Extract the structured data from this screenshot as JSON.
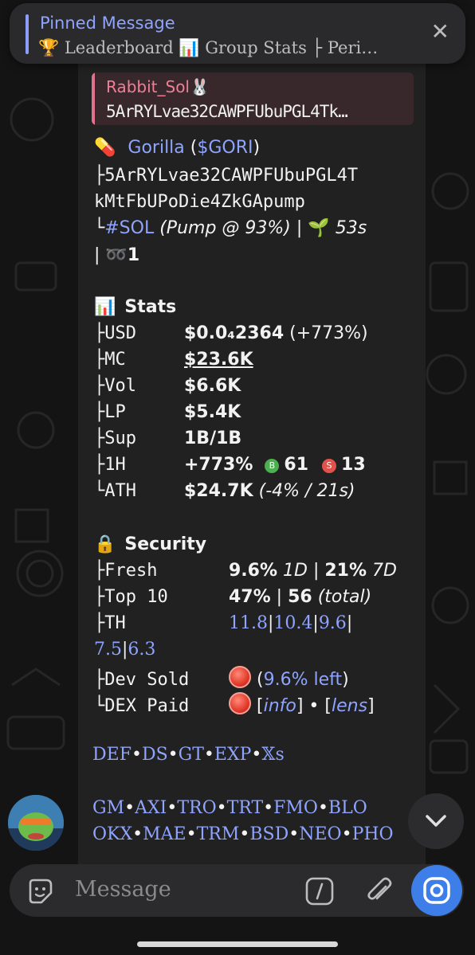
{
  "pinned": {
    "title": "Pinned Message",
    "preview": "🏆 Leaderboard  📊 Group Stats  ├ Peri…",
    "close_icon": "close-icon"
  },
  "reply": {
    "name": "Rabbit_Sol🐰",
    "text": "5ArRYLvae32CAWPFUbuPGL4Tk…"
  },
  "token": {
    "emoji": "💊",
    "name": "Gorilla",
    "ticker_open": " (",
    "ticker": "$GORI",
    "ticker_close": ")",
    "addr_line1": "├5ArRYLvae32CAWPFUbuPGL4T",
    "addr_line2": "kMtFbUPoDie4ZkGApump",
    "chain_prefix": "└",
    "chain": "#SOL",
    "pump": " (Pump @ 93%)",
    "sep": " | ",
    "age_emoji": "🌱",
    "age": " 53s",
    "line4_sep": "| ",
    "links_emoji": "➿",
    "links_count": "1"
  },
  "stats": {
    "heading_emoji": "📊",
    "heading": "Stats",
    "rows": [
      {
        "prefix": "├",
        "label": "USD",
        "value": "$0.0₄2364",
        "extra": " (+773%)"
      },
      {
        "prefix": "├",
        "label": "MC",
        "value": "$23.6K"
      },
      {
        "prefix": "├",
        "label": "Vol",
        "value": "$6.6K"
      },
      {
        "prefix": "├",
        "label": "LP",
        "value": "$5.4K"
      },
      {
        "prefix": "├",
        "label": "Sup",
        "value": "1B/1B"
      },
      {
        "prefix": "├",
        "label": "1H",
        "value": "+773%",
        "buys_icon": "B",
        "buys": "61",
        "sells_icon": "S",
        "sells": "13"
      },
      {
        "prefix": "└",
        "label": "ATH",
        "value": "$24.7K",
        "extra": " (-4% / 21s)"
      }
    ],
    "buy_color": "#4caf50",
    "sell_color": "#e0524a"
  },
  "security": {
    "heading_emoji": "🔒",
    "heading": "Security",
    "fresh_label": "├Fresh",
    "fresh_1d": "9.6%",
    "fresh_1d_unit": " 1D",
    "fresh_sep": " | ",
    "fresh_7d": "21%",
    "fresh_7d_unit": " 7D",
    "top10_label": "├Top 10",
    "top10_value": "47%",
    "top10_sep": " | ",
    "top10_total": "56",
    "top10_total_label": " (total)",
    "th_label": "├TH",
    "th_values": [
      "11.8",
      "10.4",
      "9.6",
      "7.5",
      "6.3"
    ],
    "dev_label": "├Dev Sold",
    "dev_open": " (",
    "dev_value": "9.6% left",
    "dev_close": ")",
    "dex_label": "└DEX Paid",
    "dex_open": " [",
    "dex_info": "info",
    "dex_mid": "] • [",
    "dex_lens": "lens",
    "dex_close": "]"
  },
  "links_row1": [
    "DEF",
    "DS",
    "GT",
    "EXP",
    "𝕏s"
  ],
  "links_row2": [
    "GM",
    "AXI",
    "TRO",
    "TRT",
    "FMO",
    "BLO"
  ],
  "links_row3": [
    "OKX",
    "MAE",
    "TRM",
    "BSD",
    "NEO",
    "PHO"
  ],
  "composer": {
    "placeholder": "Message"
  },
  "colors": {
    "link": "#8ea4ff",
    "accent_send": "#3e7ee8",
    "reply_accent": "#e0728e"
  }
}
